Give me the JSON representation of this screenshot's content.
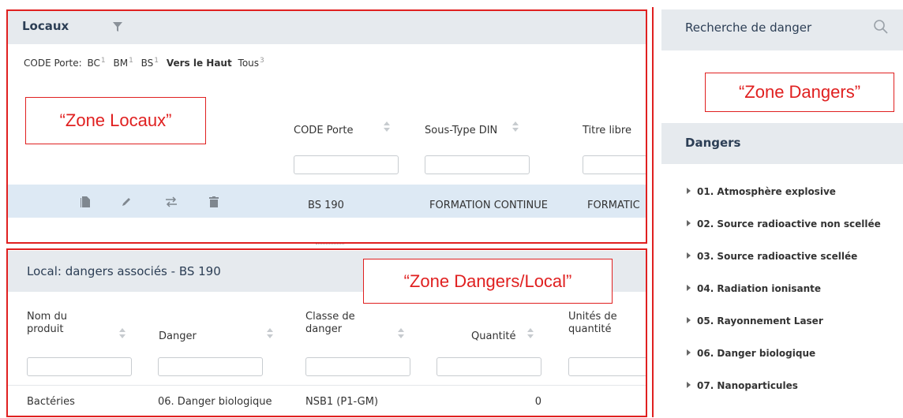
{
  "locaux": {
    "title": "Locaux",
    "code_porte_label": "CODE Porte:",
    "code_filters": [
      {
        "label": "BC",
        "count": "1"
      },
      {
        "label": "BM",
        "count": "1"
      },
      {
        "label": "BS",
        "count": "1"
      }
    ],
    "vers_le_haut": "Vers le Haut",
    "tous": {
      "label": "Tous",
      "count": "3"
    },
    "columns": [
      "CODE Porte",
      "Sous-Type DIN",
      "Titre libre"
    ],
    "row": {
      "code_porte": "BS 190",
      "sous_type": "FORMATION CONTINUE",
      "titre": "FORMATIC"
    }
  },
  "local_dangers": {
    "title": "Local: dangers associés - BS 190",
    "columns": [
      "Nom du produit",
      "Danger",
      "Classe de danger",
      "Quantité",
      "Unités de quantité"
    ],
    "rows": [
      {
        "nom": "Bactéries",
        "danger": "06. Danger biologique",
        "classe": "NSB1 (P1-GM)",
        "quantite": "0",
        "unites": ""
      }
    ]
  },
  "recherche": {
    "title": "Recherche de danger"
  },
  "dangers": {
    "title": "Dangers",
    "items": [
      "01. Atmosphère explosive",
      "02. Source radioactive non scellée",
      "03. Source radioactive scellée",
      "04. Radiation ionisante",
      "05. Rayonnement Laser",
      "06. Danger biologique",
      "07. Nanoparticules"
    ]
  },
  "annotations": {
    "zone_locaux": "“Zone Locaux”",
    "zone_dangers": "“Zone Dangers”",
    "zone_dangers_local": "“Zone Dangers/Local”"
  },
  "colors": {
    "annotation": "#e02020",
    "selected_row": "#dde9f4",
    "header_band": "#e6eaee"
  }
}
